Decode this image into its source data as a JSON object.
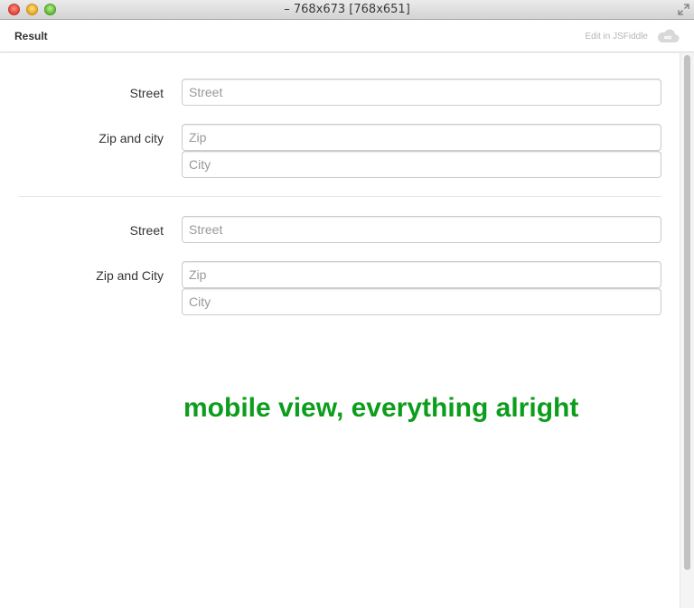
{
  "window": {
    "title": "– 768x673 [768x651]"
  },
  "header": {
    "result_label": "Result",
    "edit_link": "Edit in JSFiddle"
  },
  "forms": [
    {
      "street_label": "Street",
      "street_placeholder": "Street",
      "zip_city_label": "Zip and city",
      "zip_placeholder": "Zip",
      "city_placeholder": "City"
    },
    {
      "street_label": "Street",
      "street_placeholder": "Street",
      "zip_city_label": "Zip and City",
      "zip_placeholder": "Zip",
      "city_placeholder": "City"
    }
  ],
  "note": {
    "text": "mobile view, everything alright",
    "color": "#0d9d1c"
  },
  "icons": {
    "close": "close-icon",
    "minimize": "minimize-icon",
    "maximize": "maximize-icon",
    "resize": "resize-icon",
    "jsfiddle": "jsfiddle-cloud-icon"
  }
}
